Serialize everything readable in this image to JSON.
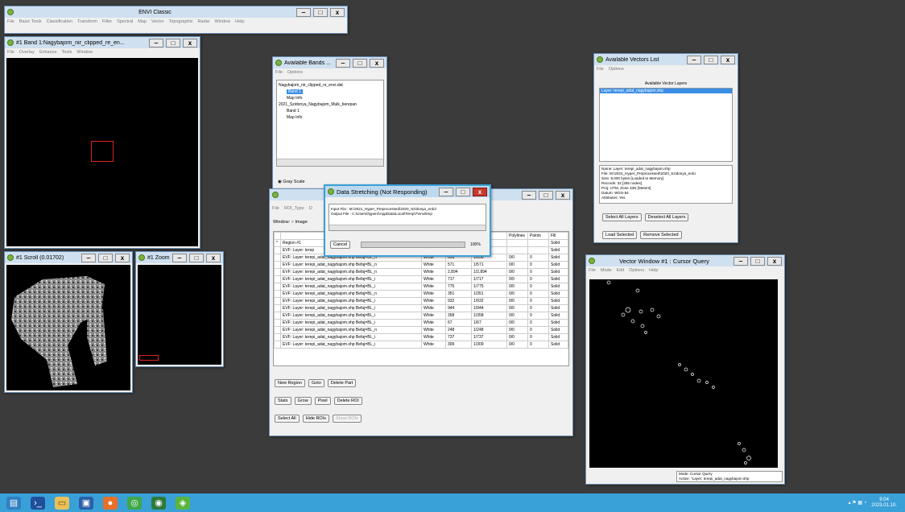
{
  "main": {
    "title": "ENVI Classic",
    "menu": [
      "File",
      "Basic Tools",
      "Classification",
      "Transform",
      "Filter",
      "Spectral",
      "Map",
      "Vector",
      "Topographic",
      "Radar",
      "Window",
      "Help"
    ]
  },
  "band": {
    "title": "#1 Band 1:Nagybajom_nir_clipped_re_en...",
    "menu": [
      "File",
      "Overlay",
      "Enhance",
      "Tools",
      "Window"
    ]
  },
  "scroll": {
    "title": "#1 Scroll (0.01702)"
  },
  "zoom": {
    "title": "#1 Zoom [..."
  },
  "avail": {
    "title": "Available Bands ...",
    "menu": [
      "File",
      "Options"
    ],
    "tree": [
      "Nagybajom_nir_clipped_re_envi.dat",
      "Band 1",
      "Map Info",
      "2021_Szidonya_Nagybajom_Mulk_berepan",
      "Band 1",
      "Map Info"
    ],
    "gray": "Gray Scale"
  },
  "vectors": {
    "title": "Available Vectors List",
    "menu": [
      "File",
      "Options"
    ],
    "header": "Available Vector Layers",
    "layer": "Layer: terepi_adat_nagybajom.shp",
    "info": [
      "Name: Layer: terepi_adat_nagybajom.shp",
      "File: M:\\2021_Hyper_Preprocessed\\2020_Szidonya_erdo",
      "Size: 8,000 bytes [Loaded to Memory]",
      "Records: 32 [255 nodes]",
      "Proj: UTM, Zone 33N [Meters]",
      "Datum: WGS-84",
      "Attributes: Yes"
    ],
    "btns": [
      "Select All Layers",
      "Deselect All Layers",
      "Load Selected",
      "Remove Selected"
    ]
  },
  "roi": {
    "menu": [
      "File",
      "ROI_Type",
      "O"
    ],
    "window_label": "Window:",
    "image_label": "Image",
    "cols": [
      "Polylines",
      "Points",
      "Fill"
    ],
    "rows": [
      [
        "Region #1",
        "",
        "",
        "",
        "",
        "Solid"
      ],
      [
        "EVF: Layer: terep",
        "",
        "",
        "",
        "",
        "Solid"
      ],
      [
        "EVF: Layer: terepi_adat_nagybajom.shp Befaj=BL_n",
        "White",
        "636",
        "1/636",
        "0/0",
        "0",
        "Solid"
      ],
      [
        "EVF: Layer: terepi_adat_nagybajom.shp Befaj=BL_n",
        "White",
        "571",
        "1/571",
        "0/0",
        "0",
        "Solid"
      ],
      [
        "EVF: Layer: terepi_adat_nagybajom.shp Befaj=BL_n",
        "White",
        "2,894",
        "1/2,894",
        "0/0",
        "0",
        "Solid"
      ],
      [
        "EVF: Layer: terepi_adat_nagybajom.shp Befaj=BL_i",
        "White",
        "717",
        "1/717",
        "0/0",
        "0",
        "Solid"
      ],
      [
        "EVF: Layer: terepi_adat_nagybajom.shp Befaj=BL_i",
        "White",
        "775",
        "1/775",
        "0/0",
        "0",
        "Solid"
      ],
      [
        "EVF: Layer: terepi_adat_nagybajom.shp Befaj=BL_n",
        "White",
        "351",
        "1/351",
        "0/0",
        "0",
        "Solid"
      ],
      [
        "EVF: Layer: terepi_adat_nagybajom.shp Befaj=BL_i",
        "White",
        "932",
        "1/932",
        "0/0",
        "0",
        "Solid"
      ],
      [
        "EVF: Layer: terepi_adat_nagybajom.shp Befaj=BL_i",
        "White",
        "944",
        "1/944",
        "0/0",
        "0",
        "Solid"
      ],
      [
        "EVF: Layer: terepi_adat_nagybajom.shp Befaj=BL_i",
        "White",
        "358",
        "1/358",
        "0/0",
        "0",
        "Solid"
      ],
      [
        "EVF: Layer: terepi_adat_nagybajom.shp Befaj=BL_i",
        "White",
        "67",
        "1/67",
        "0/0",
        "0",
        "Solid"
      ],
      [
        "EVF: Layer: terepi_adat_nagybajom.shp Befaj=BL_n",
        "White",
        "248",
        "1/248",
        "0/0",
        "0",
        "Solid"
      ],
      [
        "EVF: Layer: terepi_adat_nagybajom.shp Befaj=BL_i",
        "White",
        "737",
        "1/737",
        "0/0",
        "0",
        "Solid"
      ],
      [
        "EVF: Layer: terepi_adat_nagybajom.shp Befaj=BL_i",
        "White",
        "309",
        "1/309",
        "0/0",
        "0",
        "Solid"
      ]
    ],
    "btns": [
      "New Region",
      "Goto",
      "Delete Part",
      "Stats",
      "Grow",
      "Pixel",
      "Delete ROI",
      "Select All",
      "Hide ROIs",
      "Show ROIs"
    ]
  },
  "stretch": {
    "title": "Data Stretching (Not Responding)",
    "input": "Input File : M:\\2021_Hyper_Preprocessed\\2020_Szidonya_erdo\\",
    "output": "Output File : C:\\Users\\hyper4\\AppData\\Local\\Temp\\7\\envi\\tmp",
    "cancel": "Cancel",
    "pct": "100%"
  },
  "vwin": {
    "title": "Vector Window #1 : Cursor Query",
    "menu": [
      "File",
      "Mode",
      "Edit",
      "Options",
      "Help"
    ],
    "mode": "Mode: Cursor Query",
    "active": "Active: \"Layer: terepi_adat_nagybajom.shp"
  },
  "clock": {
    "time": "9:04",
    "date": "2023.01.10."
  }
}
